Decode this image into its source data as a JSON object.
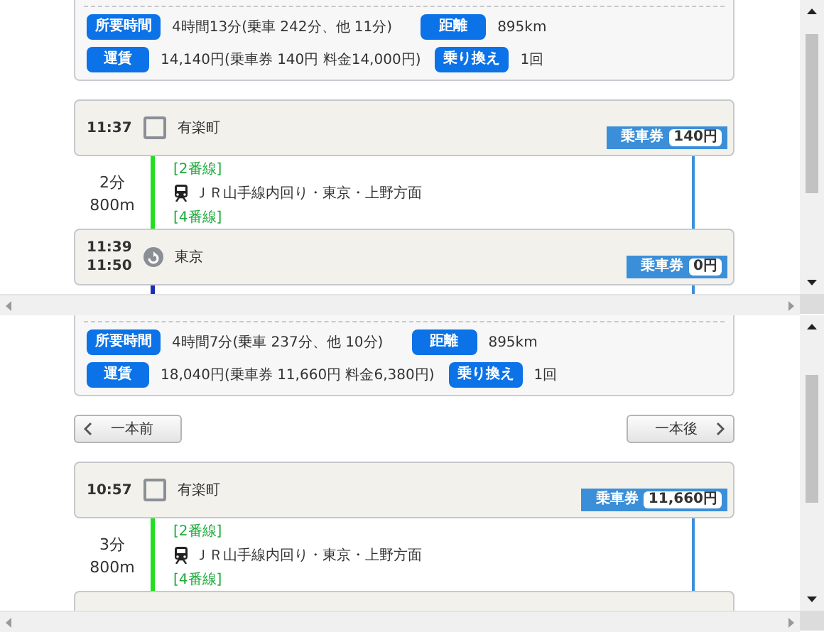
{
  "panes": [
    {
      "summary": {
        "time_label": "所要時間",
        "time": "4時間13分(乗車 242分、他 11分)",
        "distance_label": "距離",
        "distance": "895km",
        "fare_label": "運賃",
        "fare": "14,140円(乗車券 140円 料金14,000円)",
        "transfer_label": "乗り換え",
        "transfers": "1回"
      },
      "items": [
        {
          "kind": "origin",
          "times": [
            "11:37"
          ],
          "station": "有楽町",
          "ticket": {
            "label": "乗車券",
            "amount": "140円"
          }
        },
        {
          "kind": "ride",
          "duration": "2分",
          "distance": "800m",
          "from": "[2番線]",
          "line": "ＪＲ山手線内回り・東京・上野方面",
          "to": "[4番線]",
          "color": "#22dd22"
        },
        {
          "kind": "transfer",
          "times": [
            "11:39",
            "11:50"
          ],
          "station": "東京",
          "ticket": {
            "label": "乗車券",
            "amount": "0円"
          }
        },
        {
          "kind": "continuation",
          "color": "#1a2fb8"
        }
      ]
    },
    {
      "summary": {
        "time_label": "所要時間",
        "time": "4時間7分(乗車 237分、他 10分)",
        "distance_label": "距離",
        "distance": "895km",
        "fare_label": "運賃",
        "fare": "18,040円(乗車券 11,660円 料金6,380円)",
        "transfer_label": "乗り換え",
        "transfers": "1回"
      },
      "nav": {
        "prev": "一本前",
        "next": "一本後"
      },
      "items": [
        {
          "kind": "origin",
          "times": [
            "10:57"
          ],
          "station": "有楽町",
          "ticket": {
            "label": "乗車券",
            "amount": "11,660円"
          }
        },
        {
          "kind": "ride",
          "duration": "3分",
          "distance": "800m",
          "from": "[2番線]",
          "line": "ＪＲ山手線内回り・東京・上野方面",
          "to": "[4番線]",
          "color": "#22dd22"
        },
        {
          "kind": "clipped-stop"
        }
      ]
    }
  ]
}
